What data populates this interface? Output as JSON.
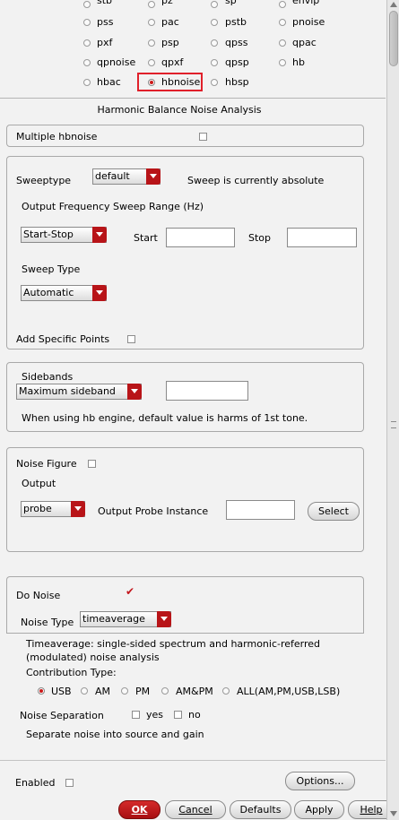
{
  "analyses": {
    "row0": [
      "stb",
      "pz",
      "sp",
      "envlp"
    ],
    "row1": [
      "pss",
      "pac",
      "pstb",
      "pnoise"
    ],
    "row2": [
      "pxf",
      "psp",
      "qpss",
      "qpac"
    ],
    "row3": [
      "qpnoise",
      "qpxf",
      "qpsp",
      "hb"
    ],
    "row4": [
      "hbac",
      "hbnoise",
      "hbsp"
    ],
    "selected": "hbnoise"
  },
  "section_title": "Harmonic Balance Noise Analysis",
  "multiple": {
    "label": "Multiple hbnoise",
    "checked": false
  },
  "sweep": {
    "sweeptype_label": "Sweeptype",
    "sweeptype_value": "default",
    "sweep_status": "Sweep is currently absolute",
    "range_label": "Output Frequency Sweep Range (Hz)",
    "range_mode": "Start-Stop",
    "start_label": "Start",
    "start_value": "",
    "stop_label": "Stop",
    "stop_value": "",
    "type_label": "Sweep Type",
    "type_value": "Automatic",
    "add_points_label": "Add Specific Points"
  },
  "sidebands": {
    "label": "Sidebands",
    "mode": "Maximum sideband",
    "value": "",
    "note": "When using hb engine, default value is harms of 1st tone."
  },
  "noise_figure": {
    "label": "Noise Figure",
    "output_label": "Output",
    "output_value": "probe",
    "probe_label": "Output Probe Instance",
    "probe_value": "",
    "select_label": "Select"
  },
  "do_noise": {
    "label": "Do Noise",
    "checked": true,
    "type_label": "Noise Type",
    "type_value": "timeaverage",
    "desc_line1": "Timeaverage: single-sided spectrum and harmonic-referred",
    "desc_line2": "(modulated) noise analysis",
    "contrib_label": "Contribution Type:",
    "contrib_options": [
      "USB",
      "AM",
      "PM",
      "AM&PM",
      "ALL(AM,PM,USB,LSB)"
    ],
    "contrib_selected": "USB",
    "separation_label": "Noise Separation",
    "yes_label": "yes",
    "no_label": "no",
    "separation_note": "Separate noise into source and gain"
  },
  "enabled_label": "Enabled",
  "options_label": "Options...",
  "footer": {
    "ok": "OK",
    "cancel": "Cancel",
    "defaults": "Defaults",
    "apply": "Apply",
    "help": "Help"
  },
  "colors": {
    "accent": "#b81418",
    "highlight_box": "#e0202a"
  }
}
